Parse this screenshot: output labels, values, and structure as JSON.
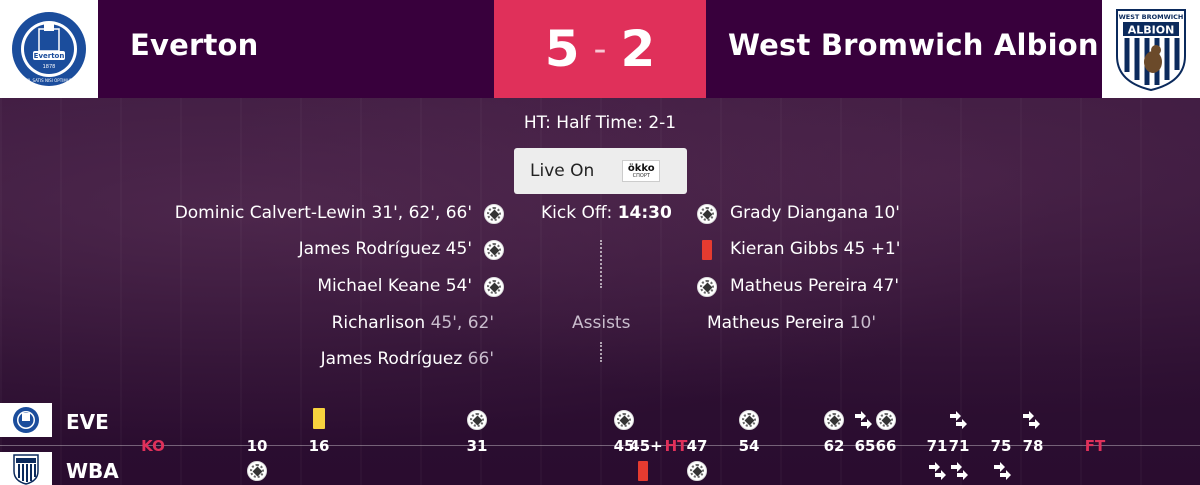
{
  "header": {
    "home_team": "Everton",
    "away_team": "West Bromwich Albion",
    "home_score": "5",
    "away_score": "2",
    "score_separator": "-",
    "home_crest_text": "Everton",
    "home_crest_year": "1878",
    "home_crest_motto": "NIL SATIS NISI OPTIMUM",
    "away_crest_text_1": "WEST BROMWICH",
    "away_crest_text_2": "ALBION"
  },
  "status": {
    "half_time": "HT: Half Time: 2-1",
    "live_on_label": "Live On",
    "broadcaster_line1": "ökko",
    "broadcaster_line2": "СПОРТ",
    "kick_off_label": "Kick Off:",
    "kick_off_time": "14:30",
    "assists_label": "Assists"
  },
  "home_events": {
    "goals": [
      {
        "player": "Dominic Calvert-Lewin 31', 62', 66'"
      },
      {
        "player": "James Rodríguez 45'"
      },
      {
        "player": "Michael Keane 54'"
      }
    ],
    "assists": [
      {
        "player": "Richarlison",
        "minutes": " 45', 62'"
      },
      {
        "player": "James Rodríguez",
        "minutes": " 66'"
      }
    ]
  },
  "away_events": {
    "events": [
      {
        "type": "goal",
        "text": "Grady Diangana 10'"
      },
      {
        "type": "red-card",
        "text": "Kieran Gibbs 45 +1'"
      },
      {
        "type": "goal",
        "text": "Matheus Pereira 47'"
      }
    ],
    "assists": [
      {
        "player": "Matheus Pereira",
        "minutes": " 10'"
      }
    ]
  },
  "timeline": {
    "home_abbr": "EVE",
    "away_abbr": "WBA",
    "labels": [
      {
        "text": "KO",
        "pink": true
      },
      {
        "text": "10"
      },
      {
        "text": "16"
      },
      {
        "text": "31"
      },
      {
        "text": "45"
      },
      {
        "text": "45+"
      },
      {
        "text": "HT",
        "pink": true
      },
      {
        "text": "47"
      },
      {
        "text": "54"
      },
      {
        "text": "62"
      },
      {
        "text": "65"
      },
      {
        "text": "66"
      },
      {
        "text": "71"
      },
      {
        "text": "71"
      },
      {
        "text": "75"
      },
      {
        "text": "78"
      },
      {
        "text": "FT",
        "pink": true
      }
    ]
  },
  "colors": {
    "header_bg": "#38003c",
    "score_bg": "#e0305a",
    "red_card": "#e53b30",
    "yellow_card": "#f7d23e"
  }
}
